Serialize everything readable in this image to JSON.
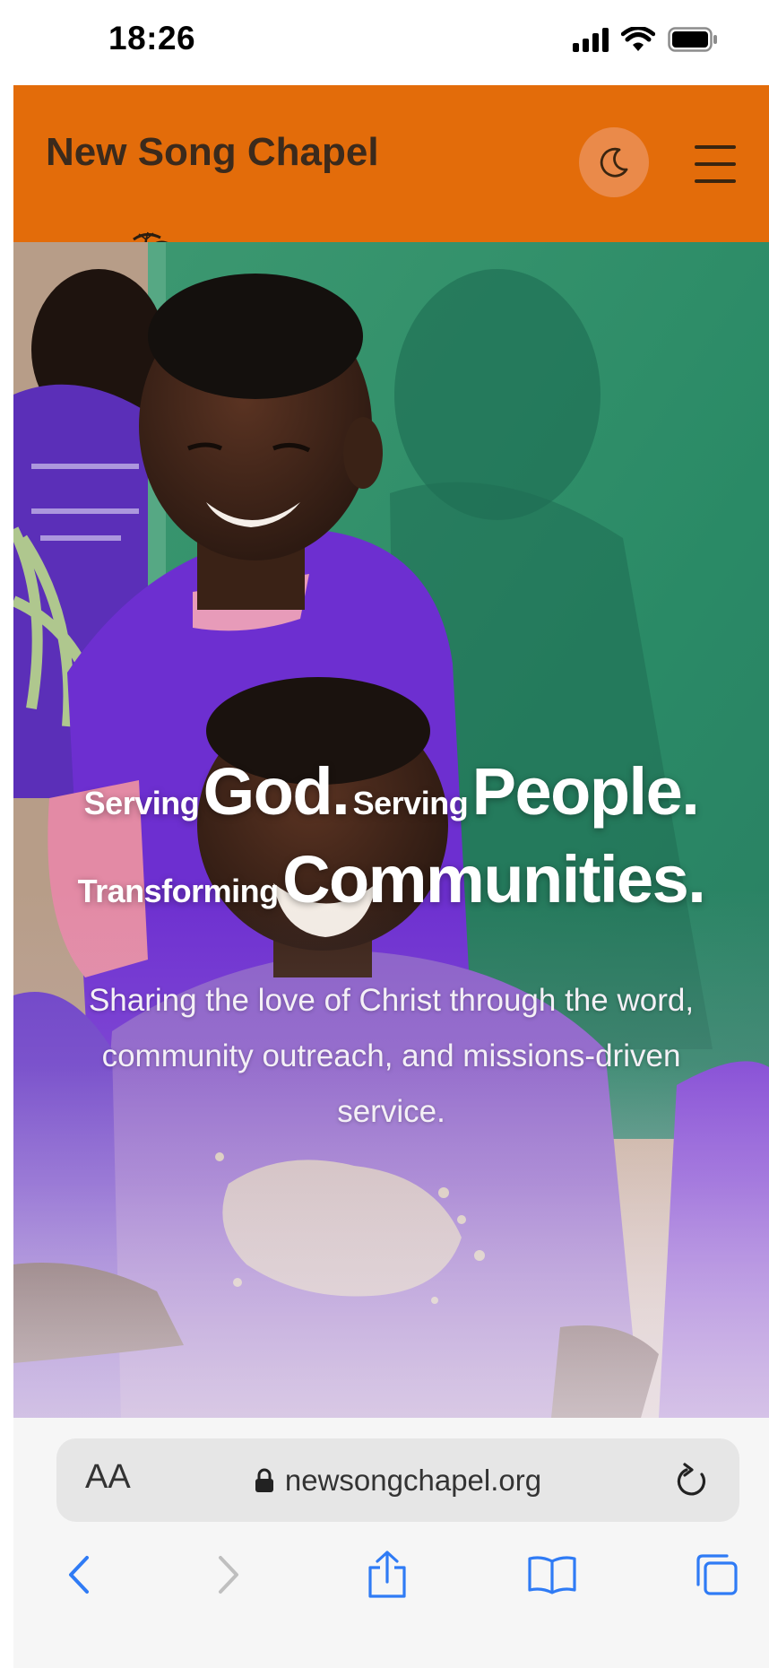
{
  "status_bar": {
    "time": "18:26",
    "icons": [
      "cellular-signal-icon",
      "wifi-icon",
      "battery-icon"
    ]
  },
  "header": {
    "logo_text": "New Song Chapel",
    "logo_art": "savanna-silhouette-logo",
    "theme_toggle_icon": "moon-icon",
    "menu_icon": "hamburger-menu-icon",
    "background_color": "#E36C0A"
  },
  "hero": {
    "image": "smiling children in purple VBS t-shirts",
    "headline": {
      "w1": "Serving",
      "w2": "God.",
      "w3": "Serving",
      "w4": "People.",
      "w5": "Transforming",
      "w6": "Communities."
    },
    "subtitle": "Sharing the love of Christ through the word, community outreach, and missions-driven service."
  },
  "browser": {
    "text_size_button": "AA",
    "url": "newsongchapel.org",
    "lock_icon": "lock-icon",
    "reload_icon": "reload-icon",
    "nav": [
      "back-icon",
      "forward-icon",
      "share-icon",
      "bookmarks-icon",
      "tabs-icon"
    ],
    "accent_color": "#2F7BF5"
  }
}
